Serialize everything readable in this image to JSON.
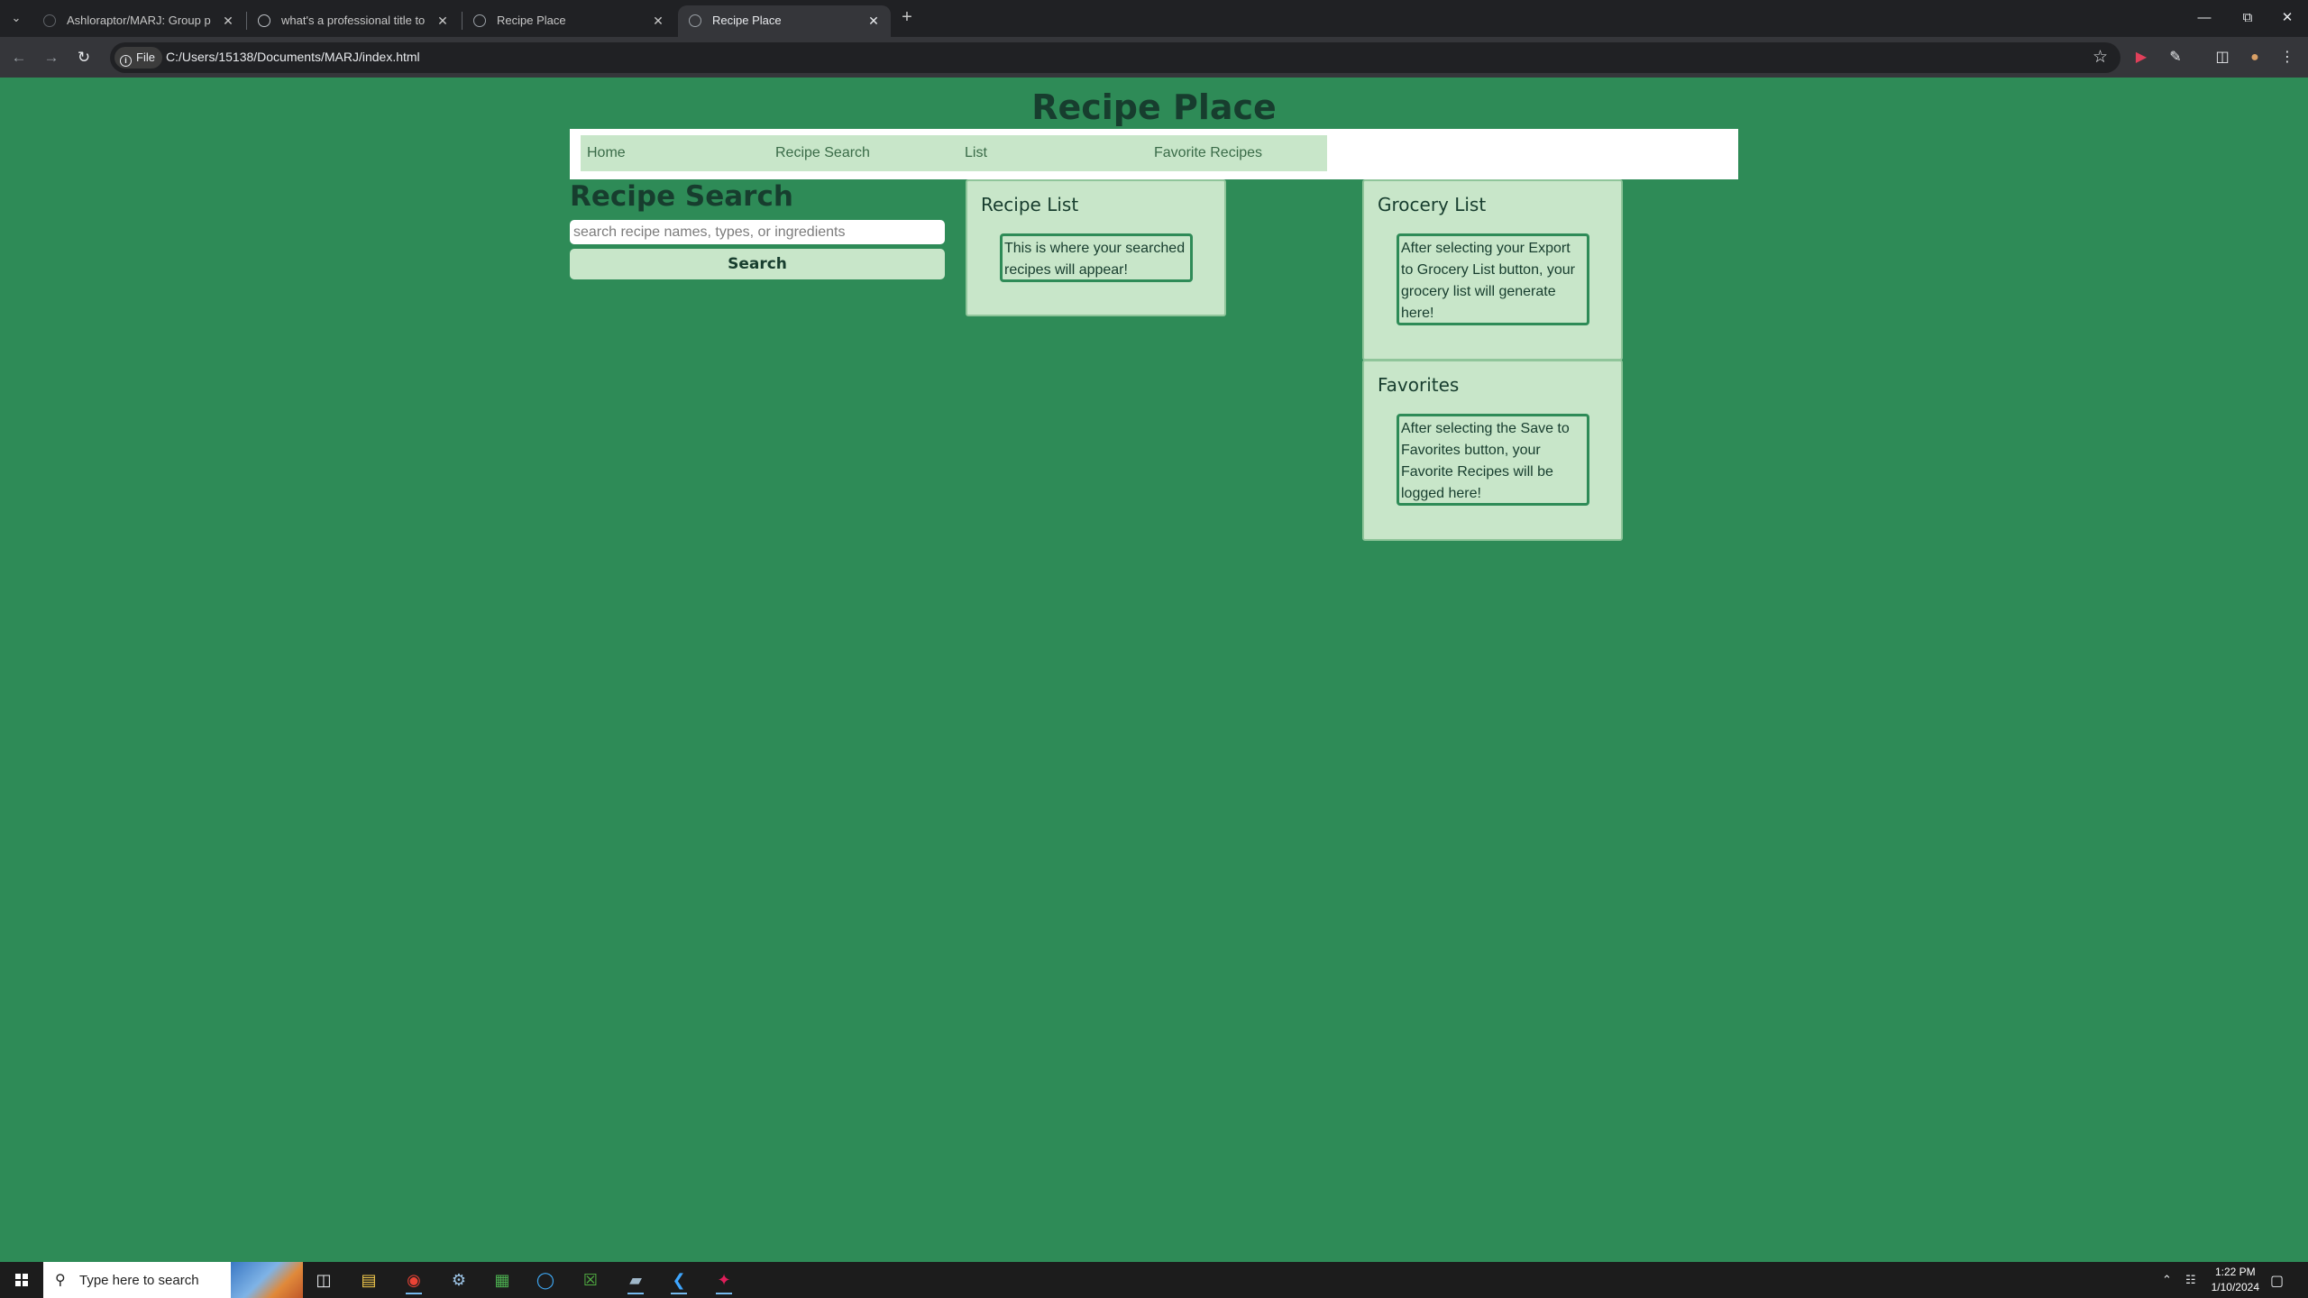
{
  "browser": {
    "tabs": [
      {
        "title": "Ashloraptor/MARJ: Group proje",
        "icon": "github-icon",
        "active": false
      },
      {
        "title": "what's a professional title to de",
        "icon": "google-icon",
        "active": false
      },
      {
        "title": "Recipe Place",
        "icon": "globe-icon",
        "active": false
      },
      {
        "title": "Recipe Place",
        "icon": "globe-icon",
        "active": true
      }
    ],
    "new_tab": "+",
    "address_chip": "File",
    "url": "C:/Users/15138/Documents/MARJ/index.html"
  },
  "site": {
    "title": "Recipe Place",
    "nav": [
      "Home",
      "Recipe Search",
      "List",
      "Favorite Recipes"
    ]
  },
  "search": {
    "heading": "Recipe Search",
    "placeholder": "search recipe names, types, or ingredients",
    "button": "Search"
  },
  "recipe_list": {
    "title": "Recipe List",
    "text": "This is where your searched recipes will appear!"
  },
  "grocery_list": {
    "title": "Grocery List",
    "text": "After selecting your Export to Grocery List button, your grocery list will generate here!"
  },
  "favorites": {
    "title": "Favorites",
    "text": "After selecting the Save to Favorites button, your Favorite Recipes will be logged here!"
  },
  "taskbar": {
    "search_placeholder": "Type here to search",
    "time": "1:22 PM",
    "date": "1/10/2024"
  },
  "colors": {
    "page_background": "#2e8b57",
    "card_background": "#c8e6c9",
    "heading_text": "#173d2e"
  }
}
